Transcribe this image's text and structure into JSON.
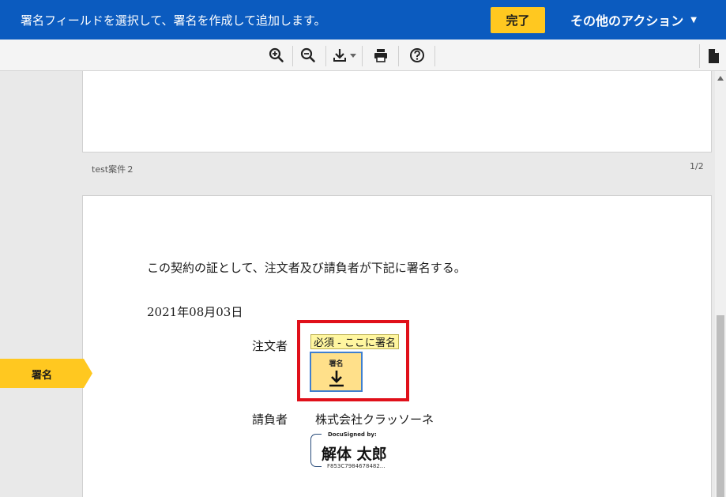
{
  "banner": {
    "message": "署名フィールドを選択して、署名を作成して追加します。",
    "finish_label": "完了",
    "other_actions_label": "その他のアクション",
    "other_actions_caret": "▼"
  },
  "toolbar": {
    "icons": [
      "zoom-in-icon",
      "zoom-out-icon",
      "download-icon",
      "print-icon",
      "help-icon",
      "document-icon"
    ]
  },
  "document": {
    "page_caption": "test案件２",
    "page_number": "1/2",
    "contract_line": "この契約の証として、注文者及び請負者が下記に署名する。",
    "date": "2021年08月03日",
    "orderer_label": "注文者",
    "required_tag": "必須 - ここに署名",
    "sign_field_label": "署名",
    "contractor_label": "請負者",
    "contractor_name": "株式会社クラッソーネ",
    "docusigned_header": "DocuSigned by:",
    "signature_name": "解体 太郎",
    "signature_hash": "F853C7984678482..."
  },
  "sidebar": {
    "sign_tab_label": "署名"
  },
  "colors": {
    "banner": "#0b5bbf",
    "accent": "#ffc820",
    "highlight": "#e0101a",
    "sign_field": "#ffe08a"
  }
}
